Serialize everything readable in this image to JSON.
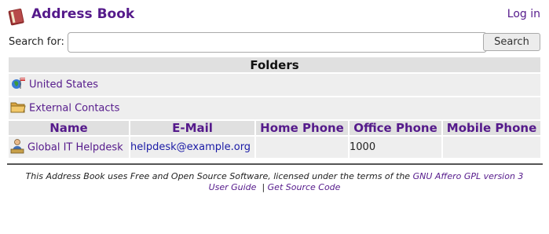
{
  "header": {
    "title": "Address Book",
    "login_label": "Log in"
  },
  "search": {
    "label": "Search for:",
    "value": "",
    "button_label": "Search"
  },
  "folders": {
    "heading": "Folders",
    "items": [
      {
        "label": "United States",
        "icon": "globe-flag-icon"
      },
      {
        "label": "External Contacts",
        "icon": "folder-icon"
      }
    ]
  },
  "columns": [
    "Name",
    "E-Mail",
    "Home Phone",
    "Office Phone",
    "Mobile Phone"
  ],
  "rows": [
    {
      "name": "Global IT Helpdesk",
      "email": "helpdesk@example.org",
      "home_phone": "",
      "office_phone": "1000",
      "mobile_phone": "",
      "icon": "contact-icon"
    }
  ],
  "footer": {
    "text": "This Address Book uses Free and Open Source Software, licensed under the terms of the",
    "license_link": "GNU Affero GPL version 3",
    "user_guide_link": "User Guide",
    "separator": "|",
    "source_link": "Get Source Code"
  },
  "colors": {
    "link": "#551a8b",
    "email": "#1a1aa6",
    "header_bg": "#e0e0e0",
    "row_bg": "#eeeeee"
  }
}
